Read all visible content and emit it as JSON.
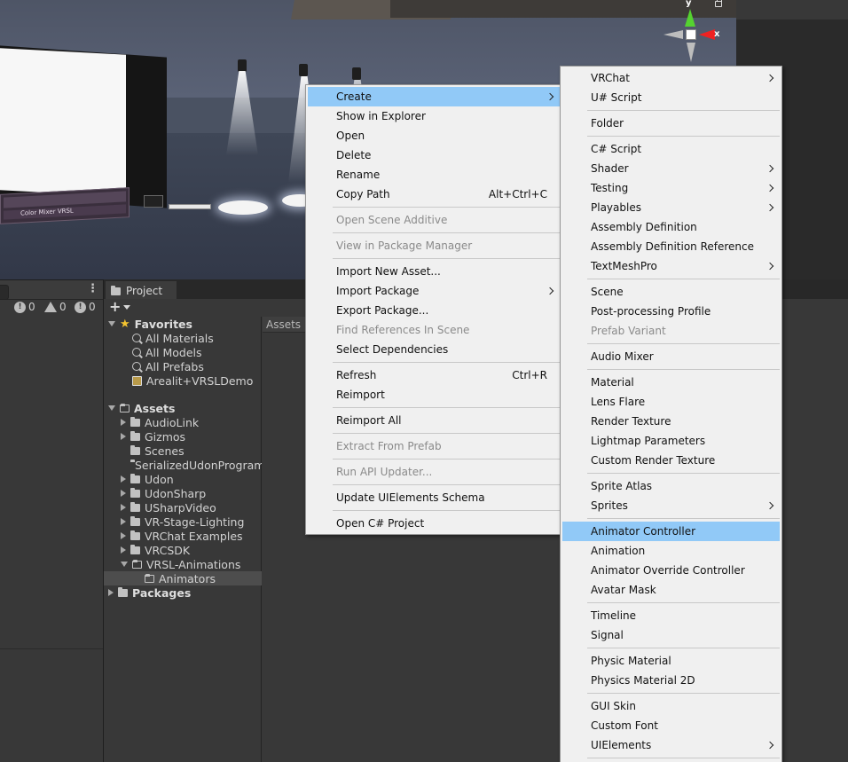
{
  "scene": {
    "gizmo": {
      "y_label": "y",
      "x_label": "x"
    },
    "panel_text": "Color Mixer VRSL"
  },
  "console": {
    "counts": [
      {
        "icon": "info-icon",
        "value": "0"
      },
      {
        "icon": "warning-icon",
        "value": "0"
      },
      {
        "icon": "error-icon",
        "value": "0"
      }
    ]
  },
  "project": {
    "tab_label": "Project",
    "assets_breadcrumb": "Assets",
    "favorites": {
      "label": "Favorites",
      "items": [
        "All Materials",
        "All Models",
        "All Prefabs",
        "Arealit+VRSLDemo"
      ]
    },
    "assets": {
      "label": "Assets",
      "items": [
        "AudioLink",
        "Gizmos",
        "Scenes",
        "SerializedUdonPrograms",
        "Udon",
        "UdonSharp",
        "USharpVideo",
        "VR-Stage-Lighting",
        "VRChat Examples",
        "VRCSDK",
        "VRSL-Animations"
      ],
      "selected_child": "Animators"
    },
    "packages_label": "Packages"
  },
  "context_menu": {
    "items": [
      {
        "label": "Create",
        "submenu": true,
        "highlighted": true
      },
      {
        "label": "Show in Explorer"
      },
      {
        "label": "Open"
      },
      {
        "label": "Delete"
      },
      {
        "label": "Rename"
      },
      {
        "label": "Copy Path",
        "shortcut": "Alt+Ctrl+C"
      },
      {
        "label": "Open Scene Additive",
        "disabled": true
      },
      {
        "label": "View in Package Manager",
        "disabled": true
      },
      {
        "label": "Import New Asset..."
      },
      {
        "label": "Import Package",
        "submenu": true
      },
      {
        "label": "Export Package..."
      },
      {
        "label": "Find References In Scene",
        "disabled": true
      },
      {
        "label": "Select Dependencies"
      },
      {
        "label": "Refresh",
        "shortcut": "Ctrl+R"
      },
      {
        "label": "Reimport"
      },
      {
        "label": "Reimport All"
      },
      {
        "label": "Extract From Prefab",
        "disabled": true
      },
      {
        "label": "Run API Updater...",
        "disabled": true
      },
      {
        "label": "Update UIElements Schema"
      },
      {
        "label": "Open C# Project"
      }
    ]
  },
  "create_submenu": {
    "items": [
      {
        "label": "VRChat",
        "submenu": true
      },
      {
        "label": "U# Script"
      },
      {
        "label": "Folder"
      },
      {
        "label": "C# Script"
      },
      {
        "label": "Shader",
        "submenu": true
      },
      {
        "label": "Testing",
        "submenu": true
      },
      {
        "label": "Playables",
        "submenu": true
      },
      {
        "label": "Assembly Definition"
      },
      {
        "label": "Assembly Definition Reference"
      },
      {
        "label": "TextMeshPro",
        "submenu": true
      },
      {
        "label": "Scene"
      },
      {
        "label": "Post-processing Profile"
      },
      {
        "label": "Prefab Variant",
        "disabled": true
      },
      {
        "label": "Audio Mixer"
      },
      {
        "label": "Material"
      },
      {
        "label": "Lens Flare"
      },
      {
        "label": "Render Texture"
      },
      {
        "label": "Lightmap Parameters"
      },
      {
        "label": "Custom Render Texture"
      },
      {
        "label": "Sprite Atlas"
      },
      {
        "label": "Sprites",
        "submenu": true
      },
      {
        "label": "Animator Controller",
        "highlighted": true
      },
      {
        "label": "Animation"
      },
      {
        "label": "Animator Override Controller"
      },
      {
        "label": "Avatar Mask"
      },
      {
        "label": "Timeline"
      },
      {
        "label": "Signal"
      },
      {
        "label": "Physic Material"
      },
      {
        "label": "Physics Material 2D"
      },
      {
        "label": "GUI Skin"
      },
      {
        "label": "Custom Font"
      },
      {
        "label": "UIElements",
        "submenu": true
      }
    ]
  },
  "colors": {
    "menu_bg": "#f0f0f0",
    "menu_highlight": "#91c9f7",
    "editor_bg": "#383838",
    "gizmo_y": "#55d330",
    "gizmo_x": "#e22222"
  }
}
